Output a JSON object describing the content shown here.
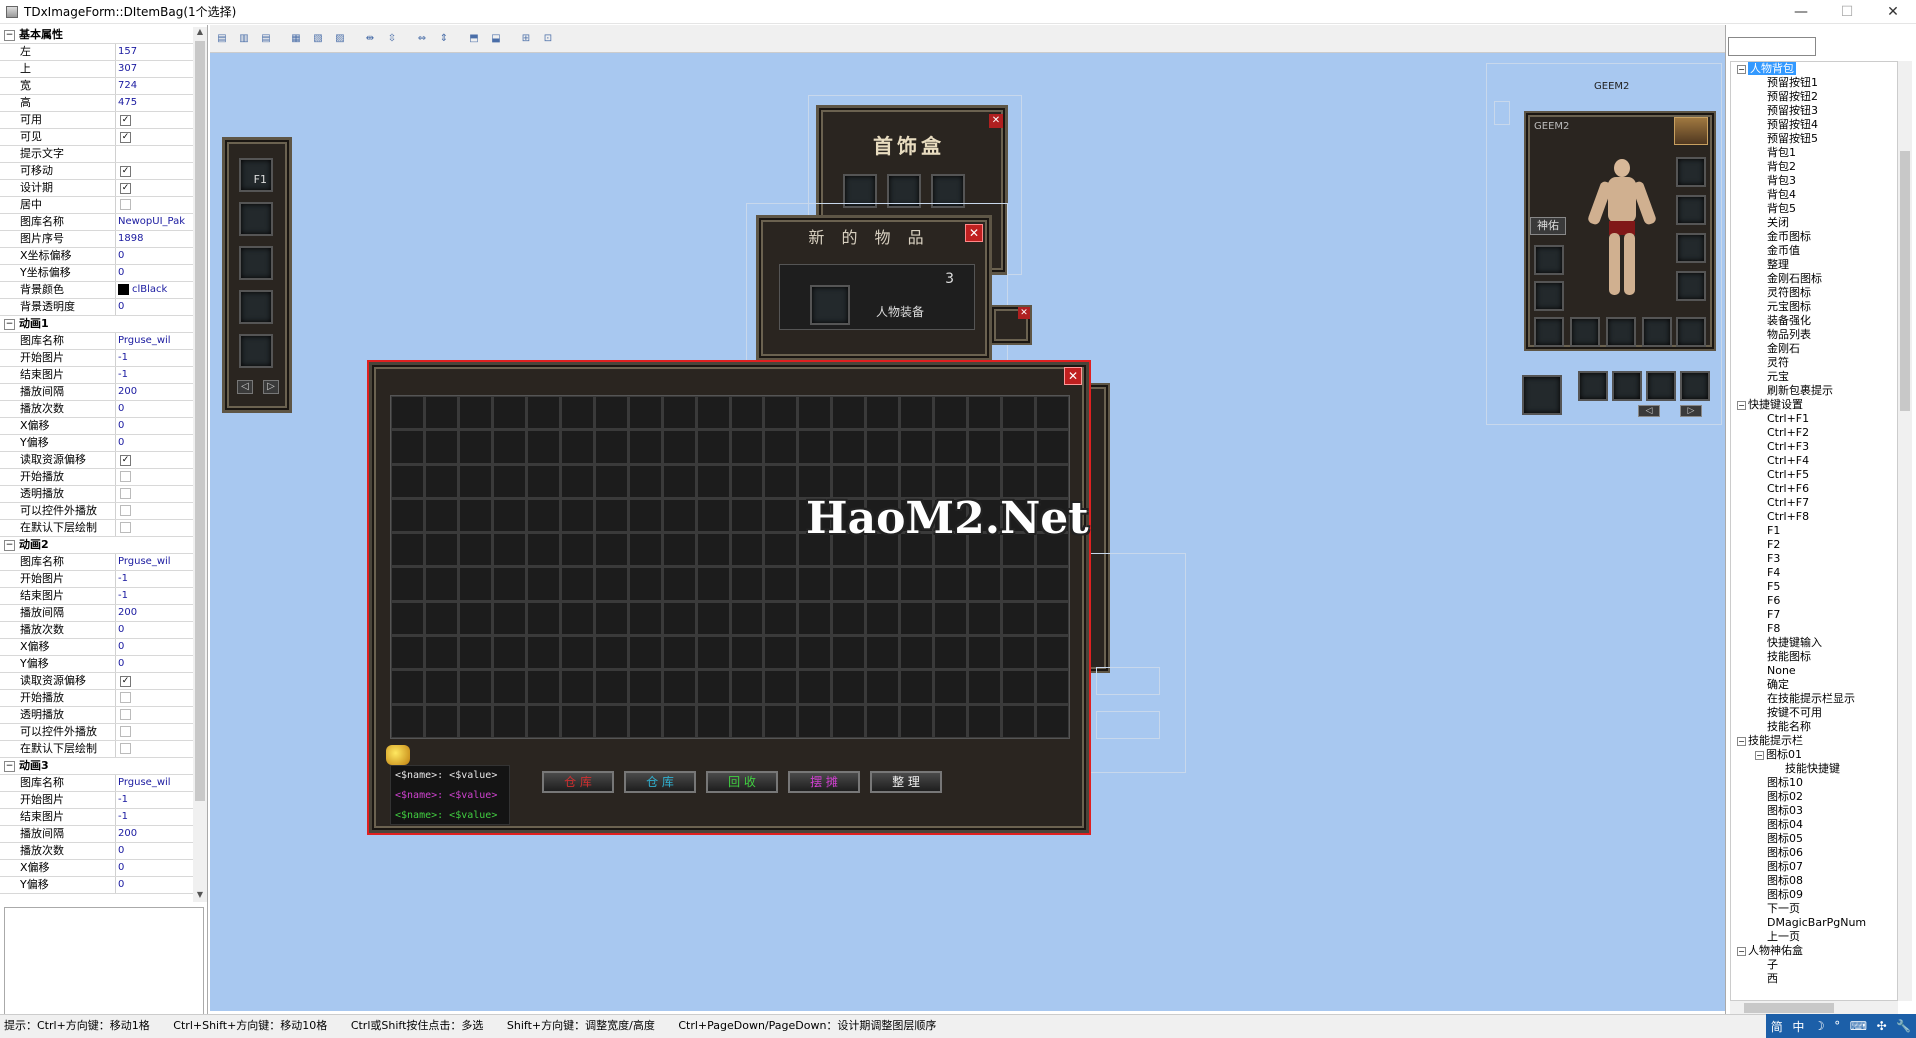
{
  "window": {
    "title": "TDxImageForm::DItemBag(1个选择)",
    "minimize": "—",
    "maximize": "☐",
    "close": "✕"
  },
  "properties": {
    "rows": [
      {
        "type": "section",
        "label": "基本属性"
      },
      {
        "label": "左",
        "value": "157"
      },
      {
        "label": "上",
        "value": "307"
      },
      {
        "label": "宽",
        "value": "724"
      },
      {
        "label": "高",
        "value": "475"
      },
      {
        "label": "可用",
        "check": true
      },
      {
        "label": "可见",
        "check": true
      },
      {
        "label": "提示文字",
        "value": ""
      },
      {
        "label": "可移动",
        "check": true
      },
      {
        "label": "设计期",
        "check": true
      },
      {
        "label": "居中",
        "check": false
      },
      {
        "label": "图库名称",
        "value": "NewopUI_Pak"
      },
      {
        "label": "图片序号",
        "value": "1898"
      },
      {
        "label": "X坐标偏移",
        "value": "0"
      },
      {
        "label": "Y坐标偏移",
        "value": "0"
      },
      {
        "label": "背景颜色",
        "value": "clBlack",
        "color": "#000000"
      },
      {
        "label": "背景透明度",
        "value": "0"
      },
      {
        "type": "section",
        "label": "动画1"
      },
      {
        "label": "图库名称",
        "value": "Prguse_wil"
      },
      {
        "label": "开始图片",
        "value": "-1"
      },
      {
        "label": "结束图片",
        "value": "-1"
      },
      {
        "label": "播放间隔",
        "value": "200"
      },
      {
        "label": "播放次数",
        "value": "0"
      },
      {
        "label": "X偏移",
        "value": "0"
      },
      {
        "label": "Y偏移",
        "value": "0"
      },
      {
        "label": "读取资源偏移",
        "check": true
      },
      {
        "label": "开始播放",
        "check": false
      },
      {
        "label": "透明播放",
        "check": false
      },
      {
        "label": "可以控件外播放",
        "check": false
      },
      {
        "label": "在默认下层绘制",
        "check": false
      },
      {
        "type": "section",
        "label": "动画2"
      },
      {
        "label": "图库名称",
        "value": "Prguse_wil"
      },
      {
        "label": "开始图片",
        "value": "-1"
      },
      {
        "label": "结束图片",
        "value": "-1"
      },
      {
        "label": "播放间隔",
        "value": "200"
      },
      {
        "label": "播放次数",
        "value": "0"
      },
      {
        "label": "X偏移",
        "value": "0"
      },
      {
        "label": "Y偏移",
        "value": "0"
      },
      {
        "label": "读取资源偏移",
        "check": true
      },
      {
        "label": "开始播放",
        "check": false
      },
      {
        "label": "透明播放",
        "check": false
      },
      {
        "label": "可以控件外播放",
        "check": false
      },
      {
        "label": "在默认下层绘制",
        "check": false
      },
      {
        "type": "section",
        "label": "动画3"
      },
      {
        "label": "图库名称",
        "value": "Prguse_wil"
      },
      {
        "label": "开始图片",
        "value": "-1"
      },
      {
        "label": "结束图片",
        "value": "-1"
      },
      {
        "label": "播放间隔",
        "value": "200"
      },
      {
        "label": "播放次数",
        "value": "0"
      },
      {
        "label": "X偏移",
        "value": "0"
      },
      {
        "label": "Y偏移",
        "value": "0"
      }
    ]
  },
  "game": {
    "jewel_box_title": "首饰盒",
    "new_item_title": "新 的 物 品",
    "new_item_count": "3",
    "new_item_label": "人物装备",
    "quickbar_f1": "F1",
    "watermark": "HaoM2.Net",
    "char_title": "GEEM2",
    "char_panel_label": "GEEM2",
    "char_tab": "神佑",
    "bag_lines": [
      {
        "text": "<$name>: <$value>",
        "color": "#e8e8e8"
      },
      {
        "text": "<$name>: <$value>",
        "color": "#d040d0"
      },
      {
        "text": "<$name>: <$value>",
        "color": "#40d040"
      }
    ],
    "bag_buttons": [
      {
        "label": "仓 库",
        "color": "#d03030"
      },
      {
        "label": "仓 库",
        "color": "#30b0d0"
      },
      {
        "label": "回 收",
        "color": "#40d040"
      },
      {
        "label": "摆 摊",
        "color": "#d040d0"
      },
      {
        "label": "整 理",
        "color": "#f0f0f0"
      }
    ]
  },
  "tree": {
    "nodes": [
      {
        "label": "人物背包",
        "level": 0,
        "exp": "−",
        "selected": true
      },
      {
        "label": "预留按钮1",
        "level": 1
      },
      {
        "label": "预留按钮2",
        "level": 1
      },
      {
        "label": "预留按钮3",
        "level": 1
      },
      {
        "label": "预留按钮4",
        "level": 1
      },
      {
        "label": "预留按钮5",
        "level": 1
      },
      {
        "label": "背包1",
        "level": 1
      },
      {
        "label": "背包2",
        "level": 1
      },
      {
        "label": "背包3",
        "level": 1
      },
      {
        "label": "背包4",
        "level": 1
      },
      {
        "label": "背包5",
        "level": 1
      },
      {
        "label": "关闭",
        "level": 1
      },
      {
        "label": "金币图标",
        "level": 1
      },
      {
        "label": "金币值",
        "level": 1
      },
      {
        "label": "整理",
        "level": 1
      },
      {
        "label": "金刚石图标",
        "level": 1
      },
      {
        "label": "灵符图标",
        "level": 1
      },
      {
        "label": "元宝图标",
        "level": 1
      },
      {
        "label": "装备强化",
        "level": 1
      },
      {
        "label": "物品列表",
        "level": 1
      },
      {
        "label": "金刚石",
        "level": 1
      },
      {
        "label": "灵符",
        "level": 1
      },
      {
        "label": "元宝",
        "level": 1
      },
      {
        "label": "刷新包裹提示",
        "level": 1
      },
      {
        "label": "快捷键设置",
        "level": 0,
        "exp": "−"
      },
      {
        "label": "Ctrl+F1",
        "level": 1
      },
      {
        "label": "Ctrl+F2",
        "level": 1
      },
      {
        "label": "Ctrl+F3",
        "level": 1
      },
      {
        "label": "Ctrl+F4",
        "level": 1
      },
      {
        "label": "Ctrl+F5",
        "level": 1
      },
      {
        "label": "Ctrl+F6",
        "level": 1
      },
      {
        "label": "Ctrl+F7",
        "level": 1
      },
      {
        "label": "Ctrl+F8",
        "level": 1
      },
      {
        "label": "F1",
        "level": 1
      },
      {
        "label": "F2",
        "level": 1
      },
      {
        "label": "F3",
        "level": 1
      },
      {
        "label": "F4",
        "level": 1
      },
      {
        "label": "F5",
        "level": 1
      },
      {
        "label": "F6",
        "level": 1
      },
      {
        "label": "F7",
        "level": 1
      },
      {
        "label": "F8",
        "level": 1
      },
      {
        "label": "快捷键输入",
        "level": 1
      },
      {
        "label": "技能图标",
        "level": 1
      },
      {
        "label": "None",
        "level": 1
      },
      {
        "label": "确定",
        "level": 1
      },
      {
        "label": "在技能提示栏显示",
        "level": 1
      },
      {
        "label": "按键不可用",
        "level": 1
      },
      {
        "label": "技能名称",
        "level": 1
      },
      {
        "label": "技能提示栏",
        "level": 0,
        "exp": "−"
      },
      {
        "label": "图标01",
        "level": 1,
        "exp": "−"
      },
      {
        "label": "技能快捷键",
        "level": 2
      },
      {
        "label": "图标10",
        "level": 1
      },
      {
        "label": "图标02",
        "level": 1
      },
      {
        "label": "图标03",
        "level": 1
      },
      {
        "label": "图标04",
        "level": 1
      },
      {
        "label": "图标05",
        "level": 1
      },
      {
        "label": "图标06",
        "level": 1
      },
      {
        "label": "图标07",
        "level": 1
      },
      {
        "label": "图标08",
        "level": 1
      },
      {
        "label": "图标09",
        "level": 1
      },
      {
        "label": "下一页",
        "level": 1
      },
      {
        "label": "DMagicBarPgNum",
        "level": 1
      },
      {
        "label": "上一页",
        "level": 1
      },
      {
        "label": "人物神佑盒",
        "level": 0,
        "exp": "−"
      },
      {
        "label": "子",
        "level": 1
      },
      {
        "label": "西",
        "level": 1
      }
    ]
  },
  "status": {
    "hints": [
      "提示：Ctrl+方向键：移动1格",
      "Ctrl+Shift+方向键：移动10格",
      "Ctrl或Shift按住点击：多选",
      "Shift+方向键：调整宽度/高度",
      "Ctrl+PageDown/PageDown：设计期调整图层顺序"
    ],
    "tray": [
      "简",
      "中",
      "☽",
      "°",
      "⌨",
      "✣",
      "🔧"
    ]
  }
}
